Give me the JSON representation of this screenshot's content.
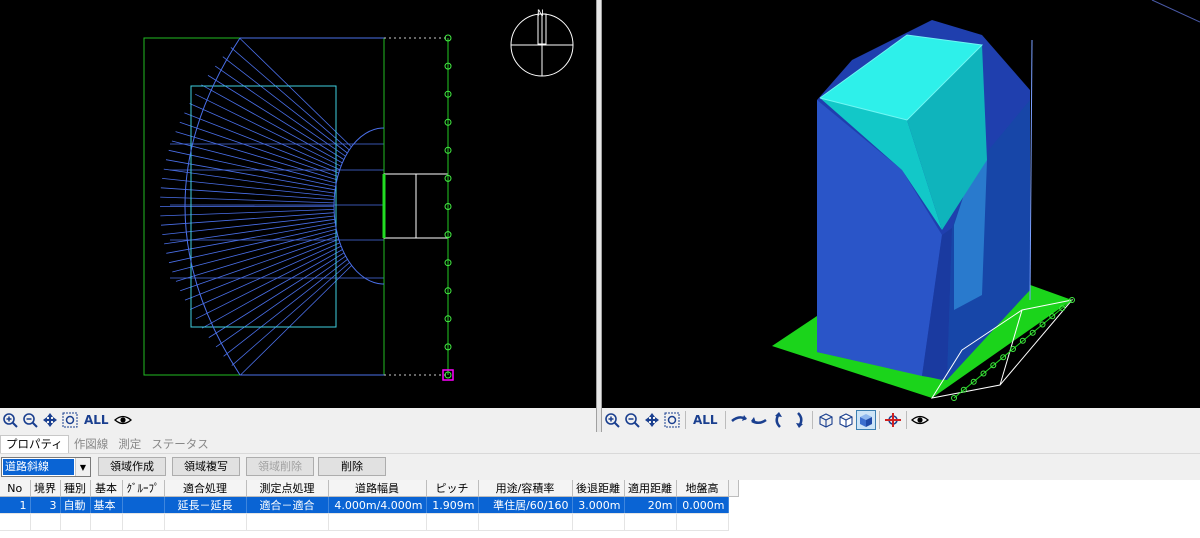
{
  "left_toolbar": {
    "all_label": "ALL",
    "icons": [
      "zoom-in-icon",
      "zoom-out-icon",
      "pan-icon",
      "zoom-window-icon"
    ],
    "eye_icon": "eye-icon"
  },
  "right_toolbar": {
    "all_label": "ALL"
  },
  "compass_label": "N",
  "tabs": [
    "プロパティ",
    "作図線",
    "測定",
    "ステータス"
  ],
  "controls": {
    "combo_value": "道路斜線",
    "create_label": "領域作成",
    "copy_label": "領域複写",
    "delete_region_label": "領域削除",
    "delete_label": "削除"
  },
  "table": {
    "headers": [
      "No",
      "境界",
      "種別",
      "基本",
      "ｸﾞﾙｰﾌﾟ",
      "適合処理",
      "測定点処理",
      "道路幅員",
      "ピッチ",
      "用途/容積率",
      "後退距離",
      "適用距離",
      "地盤高"
    ],
    "rows": [
      [
        "1",
        "3",
        "自動",
        "基本",
        "",
        "延長－延長",
        "適合－適合",
        "4.000m/4.000m",
        "1.909m",
        "準住居/60/160",
        "3.000m",
        "20m",
        "0.000m"
      ]
    ]
  },
  "colors": {
    "viewport_bg": "#000000",
    "selection": "#0a64d4",
    "plan_blue": "#4a6fe8",
    "plan_cyan": "#3fd0e0",
    "plan_green": "#22cc22",
    "massing_cyan": "#14dcd6",
    "massing_blue": "#2a55c8",
    "ground_green": "#1bd41b"
  }
}
